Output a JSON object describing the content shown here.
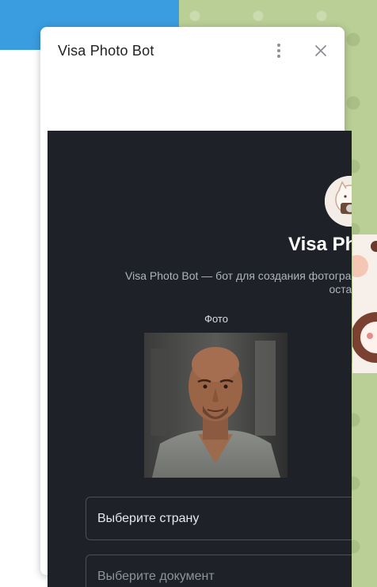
{
  "dialog": {
    "title": "Visa Photo Bot"
  },
  "webapp": {
    "bot_name": "Visa Photo Bot",
    "description_line1": "Visa Photo Bot — бот для создания фотографий на",
    "description_line2": "остал",
    "photo_label": "Фото",
    "country_select": "Выберите страну",
    "document_select": "Выберите документ"
  },
  "colors": {
    "webapp_bg": "#1e2127",
    "chat_bg": "#b9cf95",
    "header_blue": "#3a9de0"
  }
}
